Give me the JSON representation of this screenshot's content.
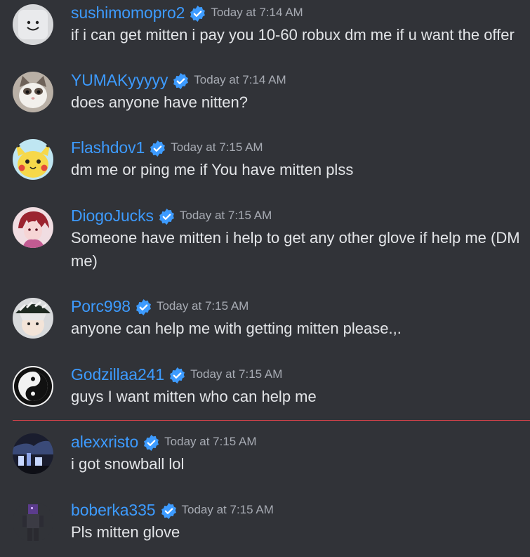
{
  "messages": [
    {
      "username": "sushimomopro2",
      "verified": true,
      "timestamp": "Today at 7:14 AM",
      "text": "if i can get mitten i pay you 10-60 robux dm me if u want the offer",
      "avatar": "roblox-smile-avatar"
    },
    {
      "username": "YUMAKyyyyy",
      "verified": true,
      "timestamp": "Today at 7:14 AM",
      "text": "does anyone have nitten?",
      "avatar": "kitten-avatar"
    },
    {
      "username": "Flashdov1",
      "verified": true,
      "timestamp": "Today at 7:15 AM",
      "text": "dm me or ping me if You have mitten plss",
      "avatar": "pikachu-avatar"
    },
    {
      "username": "DiogoJucks",
      "verified": true,
      "timestamp": "Today at 7:15 AM",
      "text": "Someone have mitten i help to get any other glove if help me (DM me)",
      "avatar": "anime-pink-avatar"
    },
    {
      "username": "Porc998",
      "verified": true,
      "timestamp": "Today at 7:15 AM",
      "text": "anyone can help me with getting mitten please.,.",
      "avatar": "anime-hat-avatar"
    },
    {
      "username": "Godzillaa241",
      "verified": true,
      "timestamp": "Today at 7:15 AM",
      "text": "guys I want mitten who can help me",
      "avatar": "yin-yang-avatar"
    },
    {
      "username": "alexxristo",
      "verified": true,
      "timestamp": "Today at 7:15 AM",
      "text": "i got snowball lol",
      "avatar": "dark-city-avatar"
    },
    {
      "username": "boberka335",
      "verified": true,
      "timestamp": "Today at 7:15 AM",
      "text": "Pls mitten glove",
      "avatar": "roblox-character-avatar"
    }
  ],
  "new_messages_divider_color": "#d2424a",
  "colors": {
    "background": "#313338",
    "username": "#3d9bff",
    "timestamp": "#a7abb3",
    "message_text": "#e3e5e8",
    "verified_badge": "#3d9bff"
  }
}
